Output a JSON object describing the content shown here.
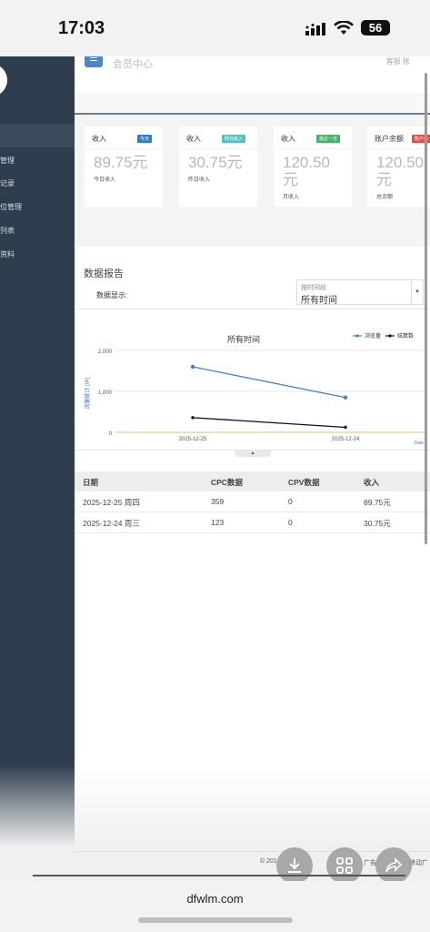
{
  "status_bar": {
    "time": "17:03",
    "battery": "56"
  },
  "sidebar": {
    "items": [
      "管理",
      "记录",
      "位管理",
      "列表",
      "资料"
    ]
  },
  "topbar": {
    "title": "会员中心",
    "right": "客服  账"
  },
  "cards": [
    {
      "title": "收入",
      "badge": "今天",
      "badge_color": "#3a7bbf",
      "value": "89.75元",
      "sub": "今日收入"
    },
    {
      "title": "收入",
      "badge": "昨日收入",
      "badge_color": "#5bc0be",
      "value": "30.75元",
      "sub": "昨日收入"
    },
    {
      "title": "收入",
      "badge": "最近一月",
      "badge_color": "#4cae6a",
      "value_line1": "120.50",
      "value_line2": "元",
      "sub": "月收入"
    },
    {
      "title": "账户余额",
      "badge": "账户余",
      "badge_color": "#d9534f",
      "value_line1": "120.50",
      "value_line2": "元",
      "sub": "总余额"
    }
  ],
  "report": {
    "title": "数据报告",
    "display_label": "数据显示:",
    "select_placeholder": "按时间段",
    "select_value": "所有时间"
  },
  "chart_data": {
    "type": "line",
    "title": "所有时间",
    "ylabel": "流量统计 (IP)",
    "xlabel": "Date",
    "x": [
      "2025-12-25",
      "2025-12-24"
    ],
    "y_ticks": [
      "2,000",
      "1,000",
      "0"
    ],
    "ylim": [
      0,
      2000
    ],
    "legend_position": "top-right",
    "series": [
      {
        "name": "浏览量",
        "values": [
          1600,
          850
        ],
        "color": "#4a7fc1"
      },
      {
        "name": "结算数",
        "values": [
          359,
          123
        ],
        "color": "#111111"
      }
    ]
  },
  "table": {
    "headers": [
      "日期",
      "CPC数据",
      "CPV数据",
      "收入"
    ],
    "rows": [
      [
        "2025-12-25 周四",
        "359",
        "0",
        "89.75元"
      ],
      [
        "2025-12-24 周三",
        "123",
        "0",
        "30.75元"
      ]
    ]
  },
  "footer": {
    "left": "© 201",
    "mid": "广告",
    "right": "移动广"
  },
  "browser": {
    "url": "dfwlm.com"
  }
}
